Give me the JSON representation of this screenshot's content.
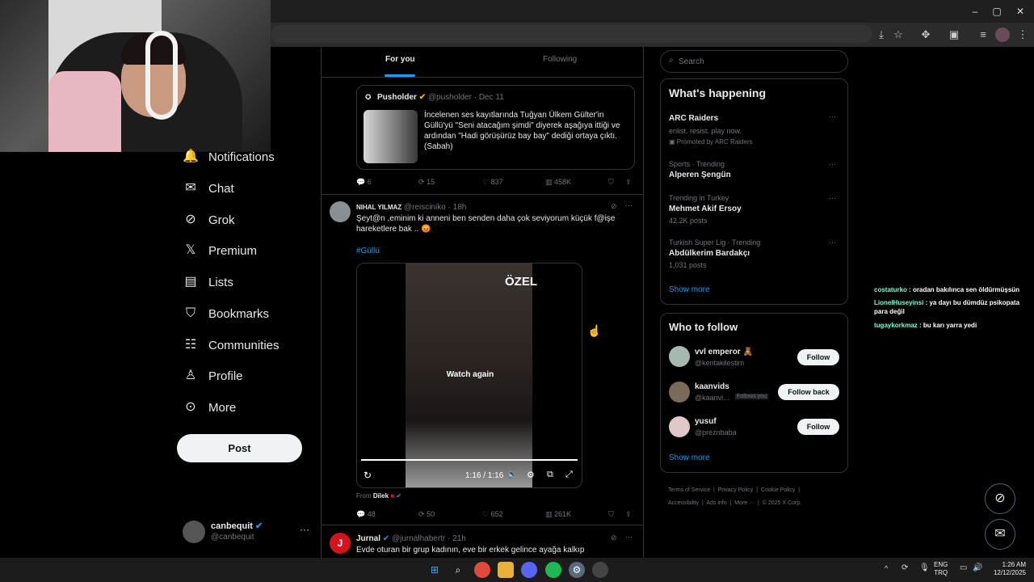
{
  "browser": {
    "window_controls": [
      "–",
      "▢",
      "✕"
    ],
    "toolbar_icons": [
      "install-icon",
      "star-icon",
      "extensions-icon",
      "sidebar-icon",
      "media-icon",
      "profile-icon",
      "menu-icon"
    ]
  },
  "nav": {
    "items": [
      {
        "label": "Notifications",
        "icon": "bell-icon",
        "glyph": "🔔"
      },
      {
        "label": "Chat",
        "icon": "mail-icon",
        "glyph": "✉"
      },
      {
        "label": "Grok",
        "icon": "grok-icon",
        "glyph": "⊘"
      },
      {
        "label": "Premium",
        "icon": "x-icon",
        "glyph": "𝕏"
      },
      {
        "label": "Lists",
        "icon": "lists-icon",
        "glyph": "▤"
      },
      {
        "label": "Bookmarks",
        "icon": "bookmark-icon",
        "glyph": "🔖"
      },
      {
        "label": "Communities",
        "icon": "communities-icon",
        "glyph": "👥"
      },
      {
        "label": "Profile",
        "icon": "profile-icon",
        "glyph": "👤"
      },
      {
        "label": "More",
        "icon": "more-circle-icon",
        "glyph": "⋯"
      }
    ],
    "post_label": "Post",
    "account_name": "canbequit",
    "account_handle": "@canbequit",
    "account_more": "···"
  },
  "tabs": {
    "for_you": "For you",
    "following": "Following"
  },
  "tweets": {
    "t1": {
      "quote_name": "Pusholder",
      "quote_meta": "@pusholder · Dec 11",
      "quote_text": "İncelenen ses kayıtlarında Tuğyan Ülkem Gülter'in Güllü'yü \"Seni atacağım şimdi\" diyerek aşağıya ittiği ve ardından \"Hadi görüşürüz bay bay\" dediği ortaya çıktı. (Sabah)",
      "replies": "6",
      "reposts": "15",
      "likes": "837",
      "views": "458K"
    },
    "t2": {
      "name": "NIHAL YILMAZ",
      "meta": "@reisciniko · 18h",
      "text": "Şeyt@n ,eminim ki anneni ben senden daha çok seviyorum küçük f@işe hareketlere bak .. 😡",
      "hashtag": "#Güllü",
      "video_overlay": "Watch again",
      "video_badge": "ÖZEL",
      "video_time": "1:16 / 1:16",
      "from_label": "From",
      "from_name": "Dilek",
      "replies": "48",
      "reposts": "50",
      "likes": "652",
      "views": "261K"
    },
    "t3": {
      "name": "Jurnal",
      "meta": "@jurnalhabertr · 21h",
      "text": "Evde oturan bir grup kadının, eve bir erkek gelince ayağa kalkıp"
    }
  },
  "right": {
    "search_placeholder": "Search",
    "happening_title": "What's happening",
    "trends": [
      {
        "context": "",
        "title": "ARC Raiders",
        "sub": "enlist. resist. play now.",
        "extra": "Promoted by ARC Raiders"
      },
      {
        "context": "Sports · Trending",
        "title": "Alperen Şengün",
        "sub": "",
        "extra": ""
      },
      {
        "context": "Trending in Turkey",
        "title": "Mehmet Akif Ersoy",
        "sub": "42.2K posts",
        "extra": ""
      },
      {
        "context": "Turkish Super Lig · Trending",
        "title": "Abdülkerim Bardakçı",
        "sub": "1,031 posts",
        "extra": ""
      }
    ],
    "show_more": "Show more",
    "wtf_title": "Who to follow",
    "follow": [
      {
        "name": "vvl emperor 🧸",
        "handle": "@kentakilestim",
        "button": "Follow",
        "badge": ""
      },
      {
        "name": "kaanvids",
        "handle": "@kaanvi...",
        "button": "Follow back",
        "badge": "Follows you"
      },
      {
        "name": "yusuf",
        "handle": "@preznbaba",
        "button": "Follow",
        "badge": ""
      }
    ],
    "show_more_2": "Show more",
    "footer": [
      "Terms of Service",
      "Privacy Policy",
      "Cookie Policy",
      "Accessibility",
      "Ads info",
      "More ···",
      "© 2025 X Corp."
    ]
  },
  "chat": [
    {
      "user": "costaturko",
      "msg": " : oradan bakılınca sen öldürmüşsün",
      "color": "#7fffd4"
    },
    {
      "user": "LionelHuseyinsi",
      "msg": " : ya dayı bu dümdüz psikopata para değil",
      "color": "#7fffd4"
    },
    {
      "user": "tugaykorkmaz",
      "msg": " : bu karı yarra yedi",
      "color": "#7fffd4"
    }
  ],
  "taskbar": {
    "lang_top": "ENG",
    "lang_bottom": "TRQ",
    "time": "1:26 AM",
    "date": "12/12/2025"
  }
}
